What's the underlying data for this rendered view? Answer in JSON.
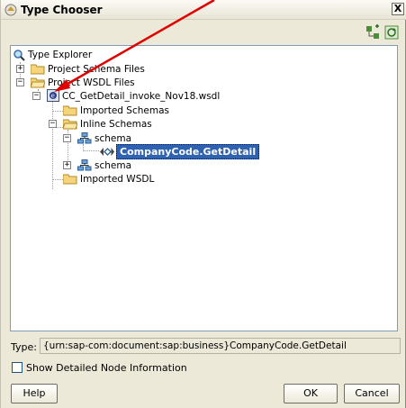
{
  "window": {
    "title": "Type Chooser",
    "close": "X"
  },
  "toolbar": {
    "btn1_icon": "expand-tree-icon",
    "btn2_icon": "refresh-tree-icon"
  },
  "tree": {
    "root": "Type Explorer",
    "schema_files": "Project Schema Files",
    "wsdl_files": "Project WSDL Files",
    "wsdl": "CC_GetDetail_invoke_Nov18.wsdl",
    "imported_schemas": "Imported Schemas",
    "inline_schemas": "Inline Schemas",
    "schema1": "schema",
    "selected": "CompanyCode.GetDetail",
    "schema2": "schema",
    "imported_wsdl": "Imported WSDL"
  },
  "type_label": "Type:",
  "type_value": "{urn:sap-com:document:sap:business}CompanyCode.GetDetail",
  "checkbox_label": "Show Detailed Node Information",
  "buttons": {
    "help": "Help",
    "ok": "OK",
    "cancel": "Cancel"
  },
  "colors": {
    "accent": "#2f62b0",
    "arrow": "#e00000",
    "window_bg": "#ece9d8"
  }
}
